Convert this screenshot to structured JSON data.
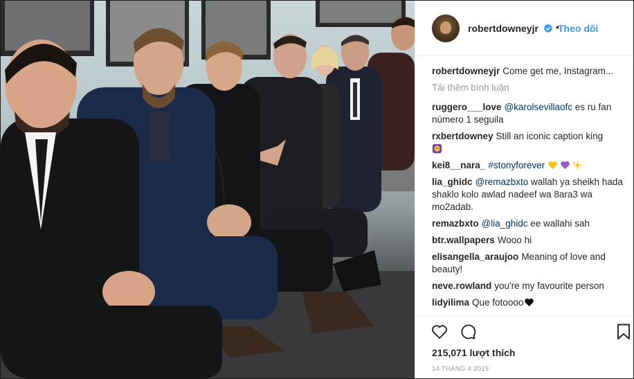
{
  "post": {
    "photo_description_icon": "group-photo",
    "author": "robertdowneyjr",
    "follow_label": "Theo dõi",
    "separator": "•"
  },
  "caption": {
    "user": "robertdowneyjr",
    "text": "Come get me, Instagram..."
  },
  "load_more_label": "Tải thêm bình luận",
  "comments": [
    {
      "user": "ruggero___love",
      "mention": "@karolsevillaofc",
      "text": " es ru fan número 1 seguila"
    },
    {
      "user": "rxbertdowney",
      "text": "Still an iconic caption king",
      "emoji_line": true
    },
    {
      "user": "kei8__nara_",
      "hashtag": "#stonyforever",
      "hearts": true
    },
    {
      "user": "lia_ghidc",
      "mention": "@remazbxto",
      "text": " wallah ya sheikh hada shaklo kolo awlad nadeef wa 8ara3 wa mo2adab."
    },
    {
      "user": "remazbxto",
      "mention": "@lia_ghidc",
      "text": " ee wallahi sah"
    },
    {
      "user": "btr.wallpapers",
      "text": "Wooo hi"
    },
    {
      "user": "elisangella_araujoo",
      "text": "Meaning of love and beauty!"
    },
    {
      "user": "neve.rowland",
      "text": "you're my favourite person"
    },
    {
      "user": "lidyilima",
      "text": "Que fotoooo",
      "black_heart": true
    }
  ],
  "likes_label": "215,071 lượt thích",
  "date_label": "14 THÁNG 4 2015",
  "colors": {
    "link": "#3897f0",
    "mention": "#003569",
    "muted": "#999999"
  }
}
